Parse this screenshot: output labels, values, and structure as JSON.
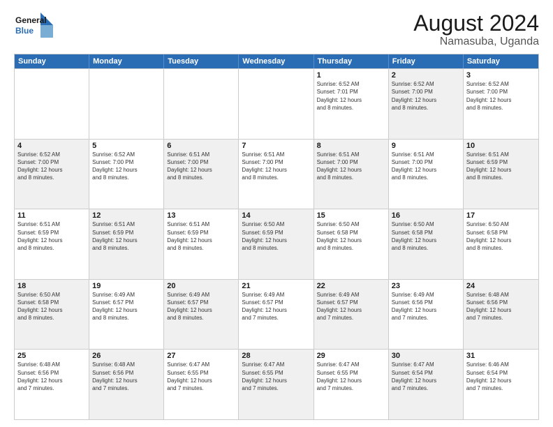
{
  "header": {
    "logo_line1": "General",
    "logo_line2": "Blue",
    "main_title": "August 2024",
    "sub_title": "Namasuba, Uganda"
  },
  "days_of_week": [
    "Sunday",
    "Monday",
    "Tuesday",
    "Wednesday",
    "Thursday",
    "Friday",
    "Saturday"
  ],
  "rows": [
    {
      "cells": [
        {
          "day": "",
          "info": "",
          "shaded": false
        },
        {
          "day": "",
          "info": "",
          "shaded": false
        },
        {
          "day": "",
          "info": "",
          "shaded": false
        },
        {
          "day": "",
          "info": "",
          "shaded": false
        },
        {
          "day": "1",
          "info": "Sunrise: 6:52 AM\nSunset: 7:01 PM\nDaylight: 12 hours\nand 8 minutes.",
          "shaded": false
        },
        {
          "day": "2",
          "info": "Sunrise: 6:52 AM\nSunset: 7:00 PM\nDaylight: 12 hours\nand 8 minutes.",
          "shaded": true
        },
        {
          "day": "3",
          "info": "Sunrise: 6:52 AM\nSunset: 7:00 PM\nDaylight: 12 hours\nand 8 minutes.",
          "shaded": false
        }
      ]
    },
    {
      "cells": [
        {
          "day": "4",
          "info": "Sunrise: 6:52 AM\nSunset: 7:00 PM\nDaylight: 12 hours\nand 8 minutes.",
          "shaded": true
        },
        {
          "day": "5",
          "info": "Sunrise: 6:52 AM\nSunset: 7:00 PM\nDaylight: 12 hours\nand 8 minutes.",
          "shaded": false
        },
        {
          "day": "6",
          "info": "Sunrise: 6:51 AM\nSunset: 7:00 PM\nDaylight: 12 hours\nand 8 minutes.",
          "shaded": true
        },
        {
          "day": "7",
          "info": "Sunrise: 6:51 AM\nSunset: 7:00 PM\nDaylight: 12 hours\nand 8 minutes.",
          "shaded": false
        },
        {
          "day": "8",
          "info": "Sunrise: 6:51 AM\nSunset: 7:00 PM\nDaylight: 12 hours\nand 8 minutes.",
          "shaded": true
        },
        {
          "day": "9",
          "info": "Sunrise: 6:51 AM\nSunset: 7:00 PM\nDaylight: 12 hours\nand 8 minutes.",
          "shaded": false
        },
        {
          "day": "10",
          "info": "Sunrise: 6:51 AM\nSunset: 6:59 PM\nDaylight: 12 hours\nand 8 minutes.",
          "shaded": true
        }
      ]
    },
    {
      "cells": [
        {
          "day": "11",
          "info": "Sunrise: 6:51 AM\nSunset: 6:59 PM\nDaylight: 12 hours\nand 8 minutes.",
          "shaded": false
        },
        {
          "day": "12",
          "info": "Sunrise: 6:51 AM\nSunset: 6:59 PM\nDaylight: 12 hours\nand 8 minutes.",
          "shaded": true
        },
        {
          "day": "13",
          "info": "Sunrise: 6:51 AM\nSunset: 6:59 PM\nDaylight: 12 hours\nand 8 minutes.",
          "shaded": false
        },
        {
          "day": "14",
          "info": "Sunrise: 6:50 AM\nSunset: 6:59 PM\nDaylight: 12 hours\nand 8 minutes.",
          "shaded": true
        },
        {
          "day": "15",
          "info": "Sunrise: 6:50 AM\nSunset: 6:58 PM\nDaylight: 12 hours\nand 8 minutes.",
          "shaded": false
        },
        {
          "day": "16",
          "info": "Sunrise: 6:50 AM\nSunset: 6:58 PM\nDaylight: 12 hours\nand 8 minutes.",
          "shaded": true
        },
        {
          "day": "17",
          "info": "Sunrise: 6:50 AM\nSunset: 6:58 PM\nDaylight: 12 hours\nand 8 minutes.",
          "shaded": false
        }
      ]
    },
    {
      "cells": [
        {
          "day": "18",
          "info": "Sunrise: 6:50 AM\nSunset: 6:58 PM\nDaylight: 12 hours\nand 8 minutes.",
          "shaded": true
        },
        {
          "day": "19",
          "info": "Sunrise: 6:49 AM\nSunset: 6:57 PM\nDaylight: 12 hours\nand 8 minutes.",
          "shaded": false
        },
        {
          "day": "20",
          "info": "Sunrise: 6:49 AM\nSunset: 6:57 PM\nDaylight: 12 hours\nand 8 minutes.",
          "shaded": true
        },
        {
          "day": "21",
          "info": "Sunrise: 6:49 AM\nSunset: 6:57 PM\nDaylight: 12 hours\nand 7 minutes.",
          "shaded": false
        },
        {
          "day": "22",
          "info": "Sunrise: 6:49 AM\nSunset: 6:57 PM\nDaylight: 12 hours\nand 7 minutes.",
          "shaded": true
        },
        {
          "day": "23",
          "info": "Sunrise: 6:49 AM\nSunset: 6:56 PM\nDaylight: 12 hours\nand 7 minutes.",
          "shaded": false
        },
        {
          "day": "24",
          "info": "Sunrise: 6:48 AM\nSunset: 6:56 PM\nDaylight: 12 hours\nand 7 minutes.",
          "shaded": true
        }
      ]
    },
    {
      "cells": [
        {
          "day": "25",
          "info": "Sunrise: 6:48 AM\nSunset: 6:56 PM\nDaylight: 12 hours\nand 7 minutes.",
          "shaded": false
        },
        {
          "day": "26",
          "info": "Sunrise: 6:48 AM\nSunset: 6:56 PM\nDaylight: 12 hours\nand 7 minutes.",
          "shaded": true
        },
        {
          "day": "27",
          "info": "Sunrise: 6:47 AM\nSunset: 6:55 PM\nDaylight: 12 hours\nand 7 minutes.",
          "shaded": false
        },
        {
          "day": "28",
          "info": "Sunrise: 6:47 AM\nSunset: 6:55 PM\nDaylight: 12 hours\nand 7 minutes.",
          "shaded": true
        },
        {
          "day": "29",
          "info": "Sunrise: 6:47 AM\nSunset: 6:55 PM\nDaylight: 12 hours\nand 7 minutes.",
          "shaded": false
        },
        {
          "day": "30",
          "info": "Sunrise: 6:47 AM\nSunset: 6:54 PM\nDaylight: 12 hours\nand 7 minutes.",
          "shaded": true
        },
        {
          "day": "31",
          "info": "Sunrise: 6:46 AM\nSunset: 6:54 PM\nDaylight: 12 hours\nand 7 minutes.",
          "shaded": false
        }
      ]
    }
  ]
}
